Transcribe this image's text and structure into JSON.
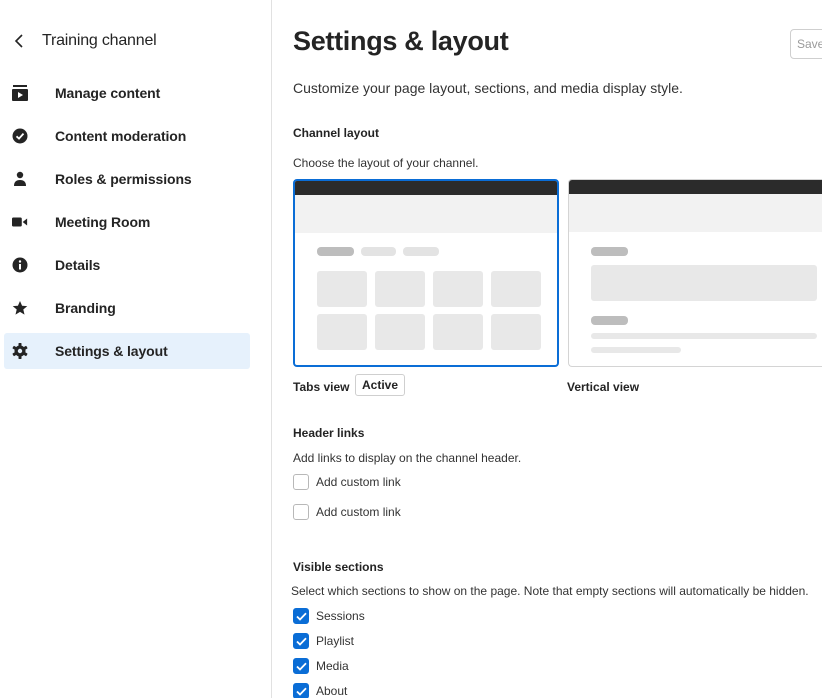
{
  "sidebar": {
    "back_title": "Training channel",
    "items": [
      {
        "label": "Manage content",
        "icon": "video-library-icon"
      },
      {
        "label": "Content moderation",
        "icon": "check-circle-icon"
      },
      {
        "label": "Roles & permissions",
        "icon": "person-icon"
      },
      {
        "label": "Meeting Room",
        "icon": "video-camera-icon"
      },
      {
        "label": "Details",
        "icon": "info-circle-icon"
      },
      {
        "label": "Branding",
        "icon": "star-icon"
      },
      {
        "label": "Settings & layout",
        "icon": "gear-icon",
        "active": true
      }
    ]
  },
  "main": {
    "title": "Settings & layout",
    "save_label": "Save",
    "subtitle": "Customize your page layout, sections, and media display style.",
    "channel_layout": {
      "heading": "Channel layout",
      "description": "Choose the layout of your channel.",
      "options": [
        {
          "label": "Tabs view",
          "badge": "Active",
          "selected": true
        },
        {
          "label": "Vertical view",
          "selected": false
        }
      ]
    },
    "header_links": {
      "heading": "Header links",
      "description": "Add links to display on the channel header.",
      "links": [
        {
          "label": "Add custom link",
          "checked": false
        },
        {
          "label": "Add custom link",
          "checked": false
        }
      ]
    },
    "visible_sections": {
      "heading": "Visible sections",
      "description": "Select which sections to show on the page. Note that empty sections will automatically be hidden.",
      "items": [
        {
          "label": "Sessions",
          "checked": true
        },
        {
          "label": "Playlist",
          "checked": true
        },
        {
          "label": "Media",
          "checked": true
        },
        {
          "label": "About",
          "checked": true
        }
      ]
    }
  },
  "colors": {
    "accent": "#0a6dd6",
    "active_nav_bg": "#e6f1fc",
    "text": "#242424"
  }
}
